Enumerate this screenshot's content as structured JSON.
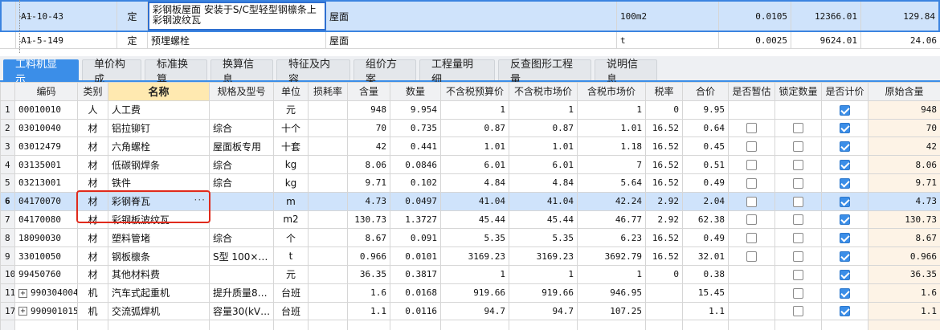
{
  "quota_rows": [
    {
      "code": "A1-10-43",
      "type": "定",
      "name": "彩钢板屋面 安装于S/C型轻型钢檩条上 彩钢波纹瓦",
      "part": "屋面",
      "unit": "100m2",
      "qty": "0.0105",
      "price": "12366.01",
      "total": "129.84"
    },
    {
      "code": "A1-5-149",
      "type": "定",
      "name": "预埋螺栓",
      "part": "屋面",
      "unit": "t",
      "qty": "0.0025",
      "price": "9624.01",
      "total": "24.06"
    }
  ],
  "tabs": [
    "工料机显示",
    "单价构成",
    "标准换算",
    "换算信息",
    "特征及内容",
    "组价方案",
    "工程量明细",
    "反查图形工程量",
    "说明信息"
  ],
  "headers": [
    "",
    "编码",
    "类别",
    "名称",
    "规格及型号",
    "单位",
    "损耗率",
    "含量",
    "数量",
    "不含税预算价",
    "不含税市场价",
    "含税市场价",
    "税率",
    "合价",
    "是否暂估",
    "锁定数量",
    "是否计价",
    "原始含量"
  ],
  "rows": [
    {
      "no": "1",
      "expand": "",
      "code": "00010010",
      "cat": "人",
      "name": "人工费",
      "spec": "",
      "unit": "元",
      "loss": "",
      "content": "948",
      "qty": "9.954",
      "pre_budget": "1",
      "pre_market": "1",
      "tax_market": "1",
      "rate": "0",
      "total": "9.95",
      "est": false,
      "lock": false,
      "priced": true,
      "orig": "948"
    },
    {
      "no": "2",
      "expand": "",
      "code": "03010040",
      "cat": "材",
      "name": "铝拉铆钉",
      "spec": "综合",
      "unit": "十个",
      "loss": "",
      "content": "70",
      "qty": "0.735",
      "pre_budget": "0.87",
      "pre_market": "0.87",
      "tax_market": "1.01",
      "rate": "16.52",
      "total": "0.64",
      "est": true,
      "lock": true,
      "priced": true,
      "orig": "70"
    },
    {
      "no": "3",
      "expand": "",
      "code": "03012479",
      "cat": "材",
      "name": "六角螺栓",
      "spec": "屋面板专用",
      "unit": "十套",
      "loss": "",
      "content": "42",
      "qty": "0.441",
      "pre_budget": "1.01",
      "pre_market": "1.01",
      "tax_market": "1.18",
      "rate": "16.52",
      "total": "0.45",
      "est": true,
      "lock": true,
      "priced": true,
      "orig": "42"
    },
    {
      "no": "4",
      "expand": "",
      "code": "03135001",
      "cat": "材",
      "name": "低碳钢焊条",
      "spec": "综合",
      "unit": "kg",
      "loss": "",
      "content": "8.06",
      "qty": "0.0846",
      "pre_budget": "6.01",
      "pre_market": "6.01",
      "tax_market": "7",
      "rate": "16.52",
      "total": "0.51",
      "est": true,
      "lock": true,
      "priced": true,
      "orig": "8.06"
    },
    {
      "no": "5",
      "expand": "",
      "code": "03213001",
      "cat": "材",
      "name": "铁件",
      "spec": "综合",
      "unit": "kg",
      "loss": "",
      "content": "9.71",
      "qty": "0.102",
      "pre_budget": "4.84",
      "pre_market": "4.84",
      "tax_market": "5.64",
      "rate": "16.52",
      "total": "0.49",
      "est": true,
      "lock": true,
      "priced": true,
      "orig": "9.71"
    },
    {
      "no": "6",
      "expand": "",
      "code": "04170070",
      "cat": "材",
      "name": "彩钢脊瓦",
      "spec": "",
      "unit": "m",
      "loss": "",
      "content": "4.73",
      "qty": "0.0497",
      "pre_budget": "41.04",
      "pre_market": "41.04",
      "tax_market": "42.24",
      "rate": "2.92",
      "total": "2.04",
      "est": true,
      "lock": true,
      "priced": true,
      "orig": "4.73",
      "selected": true
    },
    {
      "no": "7",
      "expand": "",
      "code": "04170080",
      "cat": "材",
      "name": "彩钢板波纹瓦",
      "spec": "",
      "unit": "m2",
      "loss": "",
      "content": "130.73",
      "qty": "1.3727",
      "pre_budget": "45.44",
      "pre_market": "45.44",
      "tax_market": "46.77",
      "rate": "2.92",
      "total": "62.38",
      "est": true,
      "lock": true,
      "priced": true,
      "orig": "130.73"
    },
    {
      "no": "8",
      "expand": "",
      "code": "18090030",
      "cat": "材",
      "name": "塑料管堵",
      "spec": "综合",
      "unit": "个",
      "loss": "",
      "content": "8.67",
      "qty": "0.091",
      "pre_budget": "5.35",
      "pre_market": "5.35",
      "tax_market": "6.23",
      "rate": "16.52",
      "total": "0.49",
      "est": true,
      "lock": true,
      "priced": true,
      "orig": "8.67"
    },
    {
      "no": "9",
      "expand": "",
      "code": "33010050",
      "cat": "材",
      "name": "钢板檩条",
      "spec": "S型 100×…",
      "unit": "t",
      "loss": "",
      "content": "0.966",
      "qty": "0.0101",
      "pre_budget": "3169.23",
      "pre_market": "3169.23",
      "tax_market": "3692.79",
      "rate": "16.52",
      "total": "32.01",
      "est": true,
      "lock": true,
      "priced": true,
      "orig": "0.966"
    },
    {
      "no": "10",
      "expand": "",
      "code": "99450760",
      "cat": "材",
      "name": "其他材料费",
      "spec": "",
      "unit": "元",
      "loss": "",
      "content": "36.35",
      "qty": "0.3817",
      "pre_budget": "1",
      "pre_market": "1",
      "tax_market": "1",
      "rate": "0",
      "total": "0.38",
      "est": false,
      "lock": true,
      "priced": true,
      "orig": "36.35"
    },
    {
      "no": "11",
      "expand": "+",
      "code": "990304004",
      "cat": "机",
      "name": "汽车式起重机",
      "spec": "提升质量8…",
      "unit": "台班",
      "loss": "",
      "content": "1.6",
      "qty": "0.0168",
      "pre_budget": "919.66",
      "pre_market": "919.66",
      "tax_market": "946.95",
      "rate": "",
      "total": "15.45",
      "est": false,
      "lock": true,
      "priced": true,
      "orig": "1.6"
    },
    {
      "no": "17",
      "expand": "+",
      "code": "990901015",
      "cat": "机",
      "name": "交流弧焊机",
      "spec": "容量30(kV…",
      "unit": "台班",
      "loss": "",
      "content": "1.1",
      "qty": "0.0116",
      "pre_budget": "94.7",
      "pre_market": "94.7",
      "tax_market": "107.25",
      "rate": "",
      "total": "1.1",
      "est": false,
      "lock": true,
      "priced": true,
      "orig": "1.1"
    },
    {
      "no": "",
      "expand": "",
      "code": "",
      "cat": "",
      "name": "",
      "spec": "",
      "unit": "",
      "loss": "",
      "content": "",
      "qty": "",
      "pre_budget": "",
      "pre_market": "",
      "tax_market": "",
      "rate": "",
      "total": "",
      "est": false,
      "lock": false,
      "priced": false,
      "orig": ""
    }
  ]
}
